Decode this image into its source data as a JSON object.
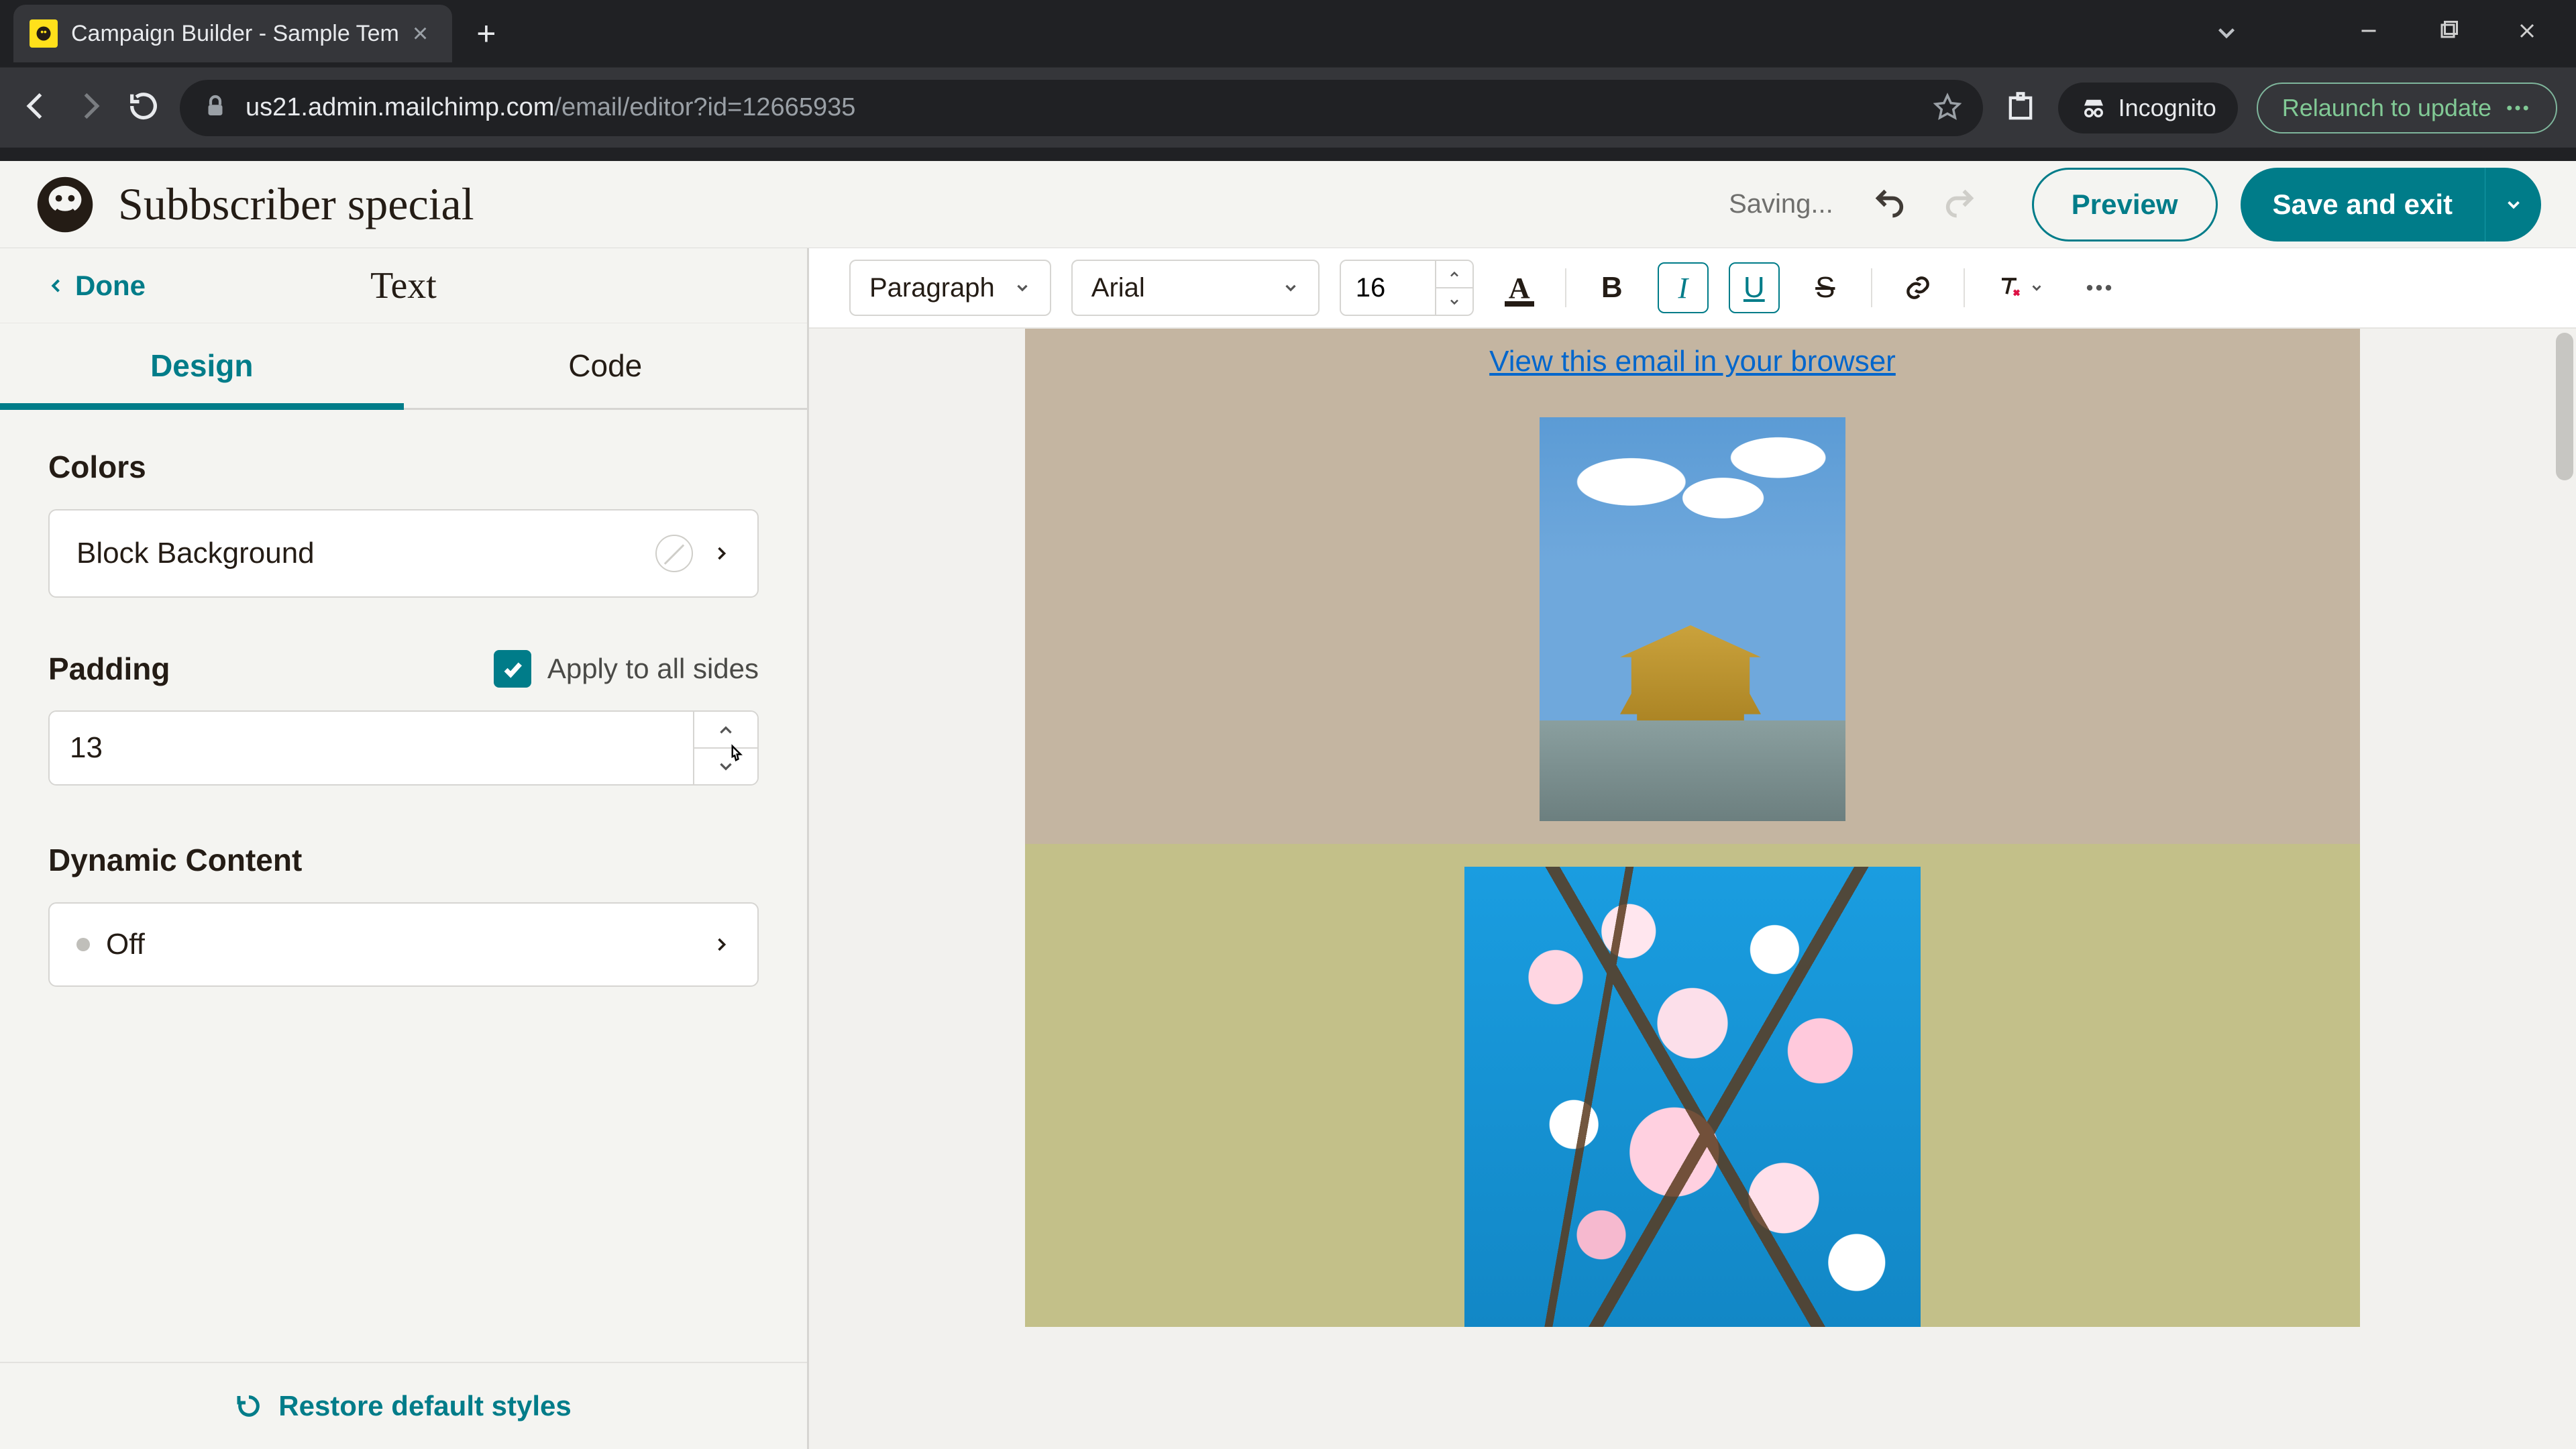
{
  "browser": {
    "tab_title": "Campaign Builder - Sample Tem",
    "url_host": "us21.admin.mailchimp.com",
    "url_path": "/email/editor?id=12665935",
    "incognito_label": "Incognito",
    "relaunch_label": "Relaunch to update"
  },
  "header": {
    "campaign_title": "Subbscriber special",
    "saving_label": "Saving...",
    "preview_label": "Preview",
    "save_label": "Save and exit"
  },
  "sidebar": {
    "done_label": "Done",
    "panel_title": "Text",
    "tabs": {
      "design": "Design",
      "code": "Code",
      "active": "design"
    },
    "colors": {
      "section_label": "Colors",
      "block_background_label": "Block Background"
    },
    "padding": {
      "section_label": "Padding",
      "apply_all_label": "Apply to all sides",
      "apply_all_checked": true,
      "value": "13"
    },
    "dynamic": {
      "section_label": "Dynamic Content",
      "status_label": "Off"
    },
    "restore_label": "Restore default styles"
  },
  "toolbar": {
    "paragraph_label": "Paragraph",
    "font_label": "Arial",
    "font_size": "16"
  },
  "email": {
    "view_in_browser": "View this email in your browser"
  }
}
